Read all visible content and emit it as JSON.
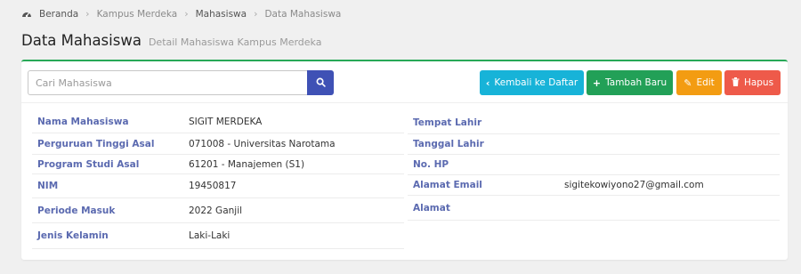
{
  "breadcrumb": {
    "home": "Beranda",
    "items": [
      "Kampus Merdeka",
      "Mahasiswa",
      "Data Mahasiswa"
    ]
  },
  "header": {
    "title": "Data Mahasiswa",
    "subtitle": "Detail Mahasiswa Kampus Merdeka"
  },
  "search": {
    "placeholder": "Cari Mahasiswa",
    "value": ""
  },
  "toolbar": {
    "back_label": "Kembali ke Daftar",
    "add_label": "Tambah Baru",
    "edit_label": "Edit",
    "delete_label": "Hapus"
  },
  "details_left": [
    {
      "label": "Nama Mahasiswa",
      "value": "SIGIT MERDEKA"
    },
    {
      "label": "Perguruan Tinggi Asal",
      "value": "071008 - Universitas Narotama"
    },
    {
      "label": "Program Studi Asal",
      "value": "61201 - Manajemen (S1)"
    },
    {
      "label": "NIM",
      "value": "19450817"
    },
    {
      "label": "Periode Masuk",
      "value": "2022 Ganjil"
    },
    {
      "label": "Jenis Kelamin",
      "value": "Laki-Laki"
    }
  ],
  "details_right": [
    {
      "label": "Tempat Lahir",
      "value": ""
    },
    {
      "label": "Tanggal Lahir",
      "value": ""
    },
    {
      "label": "No. HP",
      "value": ""
    },
    {
      "label": "Alamat Email",
      "value": "sigitekowiyono27@gmail.com"
    },
    {
      "label": "Alamat",
      "value": ""
    }
  ],
  "colors": {
    "accent_green": "#27a857",
    "search_button": "#3f51b5",
    "back_button": "#17b3d8",
    "add_button": "#22a057",
    "edit_button": "#f39c12",
    "delete_button": "#ee5a4a",
    "label_color": "#5b6ab0"
  },
  "icons": {
    "home": "dashboard-icon",
    "search": "search-icon",
    "back": "chevron-left-icon",
    "add": "plus-icon",
    "edit": "pencil-icon",
    "delete": "trash-icon"
  }
}
